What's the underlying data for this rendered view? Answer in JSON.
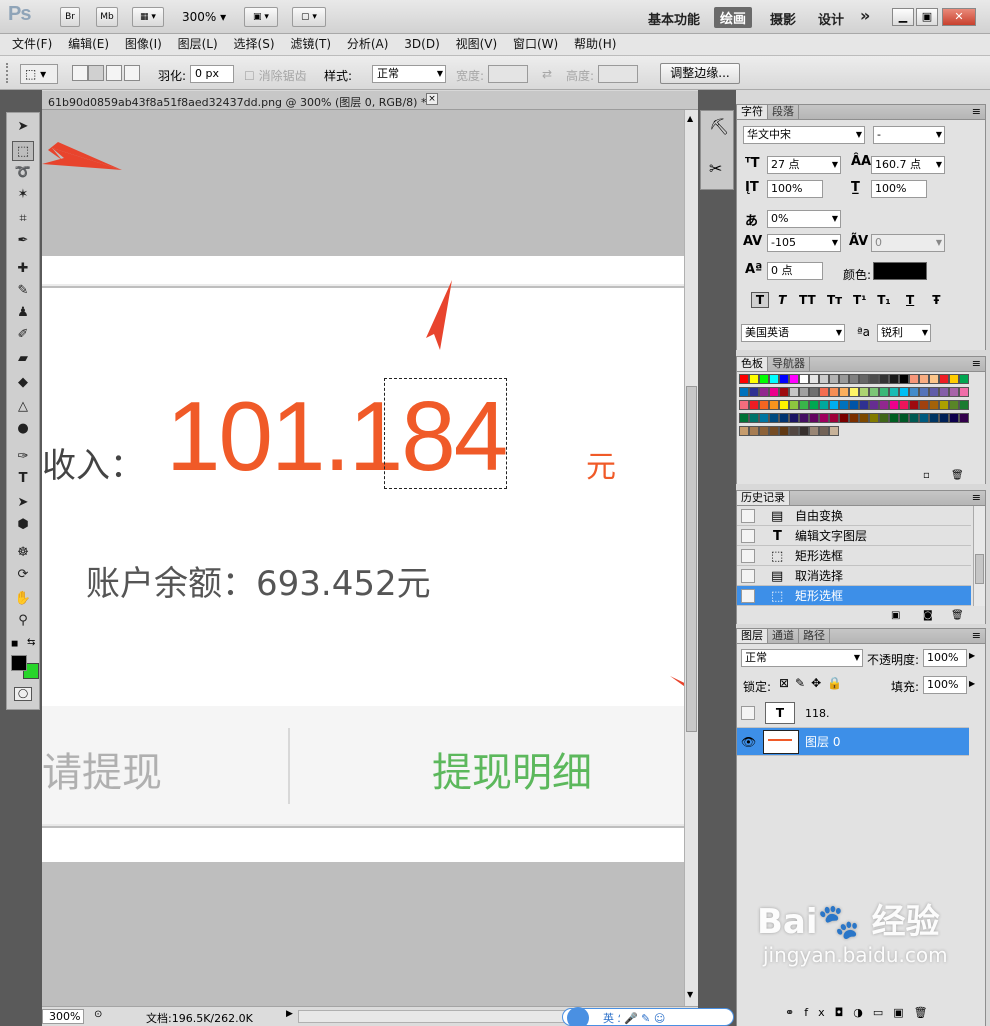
{
  "app": {
    "logo": "Ps",
    "br": "Br",
    "mb": "Mb",
    "zoom": "300%",
    "workspaces": [
      "基本功能",
      "绘画",
      "摄影",
      "设计"
    ],
    "active_workspace": "绘画",
    "more": "»"
  },
  "menu": [
    "文件(F)",
    "编辑(E)",
    "图像(I)",
    "图层(L)",
    "选择(S)",
    "滤镜(T)",
    "分析(A)",
    "3D(D)",
    "视图(V)",
    "窗口(W)",
    "帮助(H)"
  ],
  "options": {
    "feather_label": "羽化:",
    "feather_value": "0 px",
    "antialias_label": "消除锯齿",
    "style_label": "样式:",
    "style_value": "正常",
    "width_label": "宽度:",
    "height_label": "高度:",
    "refine_button": "调整边缘..."
  },
  "document": {
    "tab_title": "61b90d0859ab43f8a51f8aed32437dd.png @ 300% (图层 0, RGB/8) *",
    "close": "×",
    "income_label": "收入：",
    "income_value": "101.184",
    "income_unit": "元",
    "balance": "账户余额：693.452元",
    "withdraw": "请提现",
    "details": "提现明细"
  },
  "status": {
    "zoom": "300%",
    "doc_size": "文档:196.5K/262.0K"
  },
  "character": {
    "tabs": [
      "字符",
      "段落"
    ],
    "font": "华文中宋",
    "font_style": "-",
    "size": "27 点",
    "leading": "160.7 点",
    "v_scale": "100%",
    "h_scale": "100%",
    "tsume": "0%",
    "tracking": "-105",
    "kerning": "0",
    "baseline": "0 点",
    "color_label": "颜色:",
    "styles": [
      "T",
      "T",
      "TT",
      "Tт",
      "T¹",
      "T₁",
      "T",
      "Ŧ"
    ],
    "language": "美国英语",
    "aa_label": "ªa",
    "antialias": "锐利"
  },
  "swatches": {
    "tabs": [
      "色板",
      "导航器"
    ]
  },
  "history": {
    "tabs": [
      "历史记录"
    ],
    "items": [
      "自由变换",
      "编辑文字图层",
      "矩形选框",
      "取消选择",
      "矩形选框"
    ],
    "selected": 4
  },
  "layers": {
    "tabs": [
      "图层",
      "通道",
      "路径"
    ],
    "blend_mode": "正常",
    "opacity_label": "不透明度:",
    "opacity": "100%",
    "lock_label": "锁定:",
    "fill_label": "填充:",
    "fill": "100%",
    "items": [
      {
        "name": "118.",
        "thumb": "T"
      },
      {
        "name": "图层 0",
        "thumb": ""
      }
    ],
    "selected": 1
  },
  "colors": {
    "accent_orange": "#f05a28",
    "green_text": "#5cb85c",
    "selection_blue": "#3d8fe8",
    "foreground": "#000000",
    "background": "#27d52a"
  },
  "watermark": "Bai 经验 jingyan.baidu.com"
}
